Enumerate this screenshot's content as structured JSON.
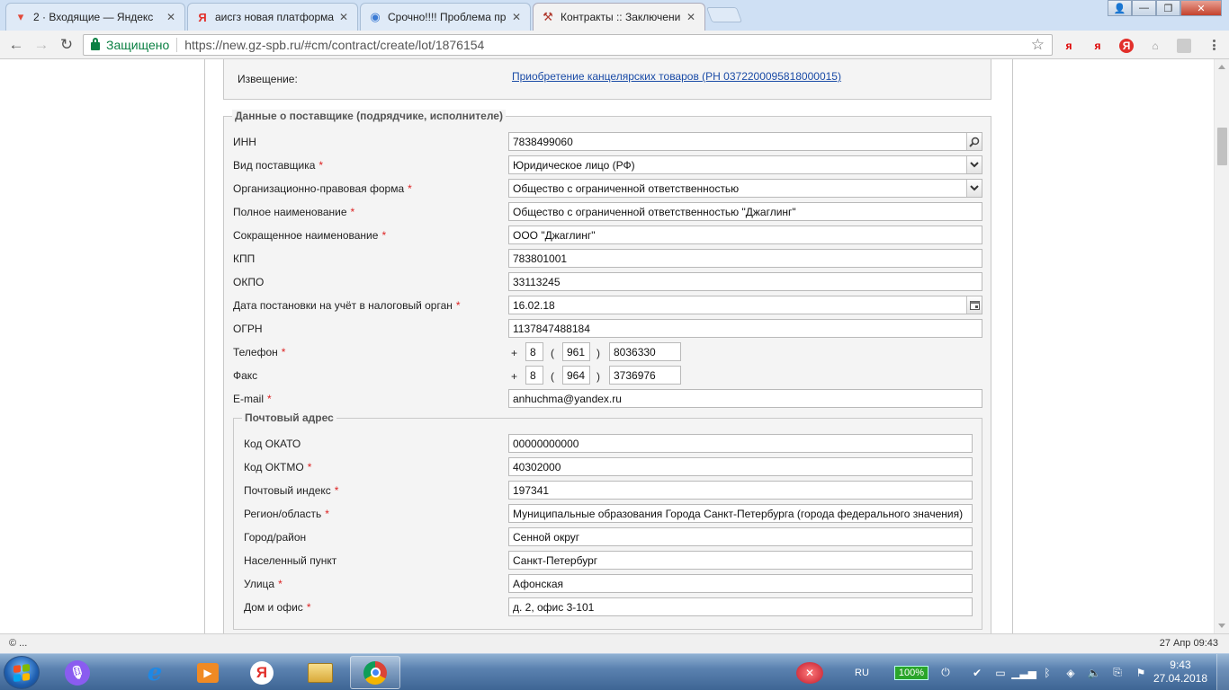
{
  "browser": {
    "tabs": [
      {
        "title": "2 · Входящие — Яндекс",
        "icon": "gmail-style-mail-icon"
      },
      {
        "title": "аисгз новая платформа",
        "icon": "yandex-icon"
      },
      {
        "title": "Срочно!!!! Проблема пр",
        "icon": "chrome-globe-icon"
      },
      {
        "title": "Контракты :: Заключени",
        "icon": "hammer-icon",
        "active": true
      }
    ],
    "secure_label": "Защищено",
    "url": "https://new.gz-spb.ru/#cm/contract/create/lot/1876154",
    "extensions": [
      "я",
      "я",
      "Я"
    ]
  },
  "form": {
    "notice": {
      "label": "Извещение:",
      "link": "Приобретение канцелярских товаров (РН 0372200095818000015)"
    },
    "supplier": {
      "legend": "Данные о поставщике (подрядчике, исполнителе)",
      "fields": {
        "inn": {
          "label": "ИНН",
          "value": "7838499060"
        },
        "type": {
          "label": "Вид поставщика",
          "value": "Юридическое лицо (РФ)"
        },
        "org_form": {
          "label": "Организационно-правовая форма",
          "value": "Общество с ограниченной ответственностью"
        },
        "full_name": {
          "label": "Полное наименование",
          "value": "Общество с ограниченной ответственностью \"Джаглинг\""
        },
        "short_name": {
          "label": "Сокращенное наименование",
          "value": "ООО \"Джаглинг\""
        },
        "kpp": {
          "label": "КПП",
          "value": "783801001"
        },
        "okpo": {
          "label": "ОКПО",
          "value": "33113245"
        },
        "tax_date": {
          "label": "Дата постановки на учёт в налоговый орган",
          "value": "16.02.18"
        },
        "ogrn": {
          "label": "ОГРН",
          "value": "1137847488184"
        },
        "phone": {
          "label": "Телефон",
          "plus": "+",
          "country": "8",
          "open": "(",
          "code": "961",
          "close": ")",
          "number": "8036330"
        },
        "fax": {
          "label": "Факс",
          "plus": "+",
          "country": "8",
          "open": "(",
          "code": "964",
          "close": ")",
          "number": "3736976"
        },
        "email": {
          "label": "E-mail",
          "value": "anhuchma@yandex.ru"
        }
      },
      "postal": {
        "legend": "Почтовый адрес",
        "fields": {
          "okato": {
            "label": "Код ОКАТО",
            "value": "00000000000"
          },
          "oktmo": {
            "label": "Код ОКТМО",
            "value": "40302000"
          },
          "index": {
            "label": "Почтовый индекс",
            "value": "197341"
          },
          "region": {
            "label": "Регион/область",
            "value": "Муниципальные образования Города Санкт-Петербурга (города федерального значения)"
          },
          "city": {
            "label": "Город/район",
            "value": "Сенной округ"
          },
          "locality": {
            "label": "Населенный пункт",
            "value": "Санкт-Петербург"
          },
          "street": {
            "label": "Улица",
            "value": "Афонская"
          },
          "house": {
            "label": "Дом и офис",
            "value": "д. 2, офис 3-101"
          }
        }
      },
      "required_mark": "*"
    }
  },
  "statusbar": {
    "left": "© ...",
    "right": "27 Апр 09:43"
  },
  "taskbar": {
    "language": "RU",
    "battery": "100%",
    "time": "9:43",
    "date": "27.04.2018"
  },
  "colors": {
    "accent_link": "#1a4ba6",
    "required": "#dd2222",
    "secure": "#0b8043"
  }
}
